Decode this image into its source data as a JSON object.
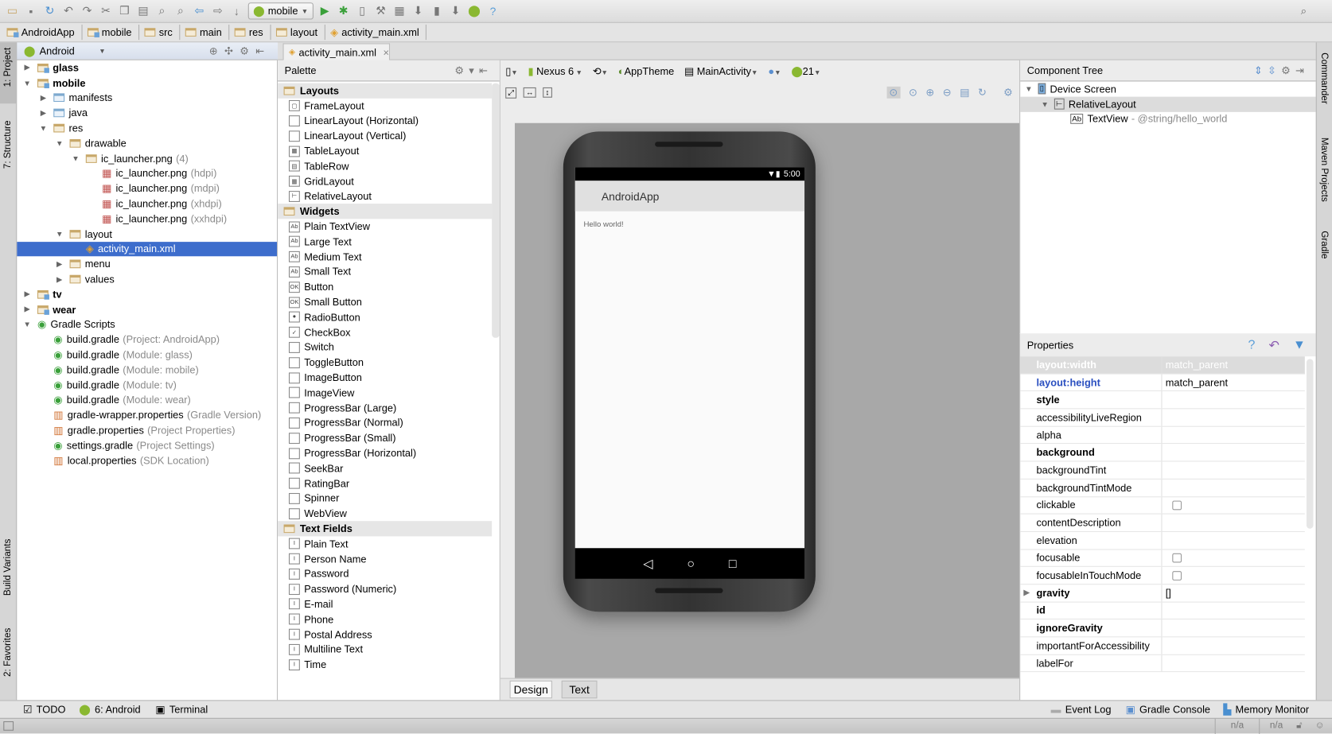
{
  "toolbar": {
    "run_config": "mobile",
    "icons": [
      "open-folder-icon",
      "save-icon",
      "sync-icon",
      "undo-icon",
      "redo-icon",
      "cut-icon",
      "copy-icon",
      "paste-icon",
      "find-icon",
      "replace-icon",
      "back-icon",
      "forward-icon",
      "make-icon",
      "run-icon",
      "debug-icon",
      "attach-debugger-icon",
      "project-structure-icon",
      "sdk-manager-icon",
      "android-device-monitor-icon",
      "avd-manager-icon",
      "sync-gradle-icon",
      "android-icon",
      "help-icon"
    ]
  },
  "breadcrumb": [
    "AndroidApp",
    "mobile",
    "src",
    "main",
    "res",
    "layout",
    "activity_main.xml"
  ],
  "left_strip": {
    "project": "1: Project",
    "structure": "7: Structure",
    "build_variants": "Build Variants",
    "favorites": "2: Favorites"
  },
  "right_strip": {
    "commander": "Commander",
    "maven": "Maven Projects",
    "gradle": "Gradle"
  },
  "project": {
    "view": "Android",
    "tree": [
      {
        "label": "glass",
        "level": 0,
        "arrow": "right",
        "icon": "module",
        "bold": true
      },
      {
        "label": "mobile",
        "level": 0,
        "arrow": "down",
        "icon": "module",
        "bold": true
      },
      {
        "label": "manifests",
        "level": 1,
        "arrow": "right",
        "icon": "blue"
      },
      {
        "label": "java",
        "level": 1,
        "arrow": "right",
        "icon": "blue"
      },
      {
        "label": "res",
        "level": 1,
        "arrow": "down",
        "icon": "res"
      },
      {
        "label": "drawable",
        "level": 2,
        "arrow": "down",
        "icon": "folder"
      },
      {
        "label": "ic_launcher.png",
        "hint": "(4)",
        "level": 3,
        "arrow": "down",
        "icon": "folder"
      },
      {
        "label": "ic_launcher.png",
        "hint": "(hdpi)",
        "level": 4,
        "icon": "image"
      },
      {
        "label": "ic_launcher.png",
        "hint": "(mdpi)",
        "level": 4,
        "icon": "image"
      },
      {
        "label": "ic_launcher.png",
        "hint": "(xhdpi)",
        "level": 4,
        "icon": "image"
      },
      {
        "label": "ic_launcher.png",
        "hint": "(xxhdpi)",
        "level": 4,
        "icon": "image"
      },
      {
        "label": "layout",
        "level": 2,
        "arrow": "down",
        "icon": "folder"
      },
      {
        "label": "activity_main.xml",
        "level": 3,
        "icon": "xml",
        "selected": true
      },
      {
        "label": "menu",
        "level": 2,
        "arrow": "right",
        "icon": "folder"
      },
      {
        "label": "values",
        "level": 2,
        "arrow": "right",
        "icon": "folder"
      },
      {
        "label": "tv",
        "level": 0,
        "arrow": "right",
        "icon": "module",
        "bold": true
      },
      {
        "label": "wear",
        "level": 0,
        "arrow": "right",
        "icon": "module",
        "bold": true
      },
      {
        "label": "Gradle Scripts",
        "level": 0,
        "arrow": "down",
        "icon": "gradle"
      },
      {
        "label": "build.gradle",
        "hint": "(Project: AndroidApp)",
        "level": 1,
        "icon": "gradle"
      },
      {
        "label": "build.gradle",
        "hint": "(Module: glass)",
        "level": 1,
        "icon": "gradle"
      },
      {
        "label": "build.gradle",
        "hint": "(Module: mobile)",
        "level": 1,
        "icon": "gradle"
      },
      {
        "label": "build.gradle",
        "hint": "(Module: tv)",
        "level": 1,
        "icon": "gradle"
      },
      {
        "label": "build.gradle",
        "hint": "(Module: wear)",
        "level": 1,
        "icon": "gradle"
      },
      {
        "label": "gradle-wrapper.properties",
        "hint": "(Gradle Version)",
        "level": 1,
        "icon": "props"
      },
      {
        "label": "gradle.properties",
        "hint": "(Project Properties)",
        "level": 1,
        "icon": "props"
      },
      {
        "label": "settings.gradle",
        "hint": "(Project Settings)",
        "level": 1,
        "icon": "gradle"
      },
      {
        "label": "local.properties",
        "hint": "(SDK Location)",
        "level": 1,
        "icon": "props"
      }
    ]
  },
  "editor_tab": "activity_main.xml",
  "palette": {
    "title": "Palette",
    "groups": [
      {
        "name": "Layouts",
        "items": [
          "FrameLayout",
          "LinearLayout (Horizontal)",
          "LinearLayout (Vertical)",
          "TableLayout",
          "TableRow",
          "GridLayout",
          "RelativeLayout"
        ]
      },
      {
        "name": "Widgets",
        "items": [
          "Plain TextView",
          "Large Text",
          "Medium Text",
          "Small Text",
          "Button",
          "Small Button",
          "RadioButton",
          "CheckBox",
          "Switch",
          "ToggleButton",
          "ImageButton",
          "ImageView",
          "ProgressBar (Large)",
          "ProgressBar (Normal)",
          "ProgressBar (Small)",
          "ProgressBar (Horizontal)",
          "SeekBar",
          "RatingBar",
          "Spinner",
          "WebView"
        ]
      },
      {
        "name": "Text Fields",
        "items": [
          "Plain Text",
          "Person Name",
          "Password",
          "Password (Numeric)",
          "E-mail",
          "Phone",
          "Postal Address",
          "Multiline Text",
          "Time"
        ]
      }
    ]
  },
  "designer": {
    "device": "Nexus 6",
    "theme": "AppTheme",
    "activity": "MainActivity",
    "api": "21",
    "phone": {
      "time": "5:00",
      "app_title": "AndroidApp",
      "content": "Hello world!"
    },
    "tabs": [
      "Design",
      "Text"
    ],
    "active_tab": "Design"
  },
  "component_tree": {
    "title": "Component Tree",
    "nodes": [
      {
        "label": "Device Screen",
        "level": 0
      },
      {
        "label": "RelativeLayout",
        "level": 1,
        "selected": true
      },
      {
        "label": "TextView",
        "hint": "- @string/hello_world",
        "level": 2
      }
    ]
  },
  "properties": {
    "title": "Properties",
    "rows": [
      {
        "name": "layout:width",
        "value": "match_parent",
        "header": true
      },
      {
        "name": "layout:height",
        "value": "match_parent",
        "modified": true
      },
      {
        "name": "style",
        "bold": true
      },
      {
        "name": "accessibilityLiveRegion"
      },
      {
        "name": "alpha"
      },
      {
        "name": "background",
        "bold": true
      },
      {
        "name": "backgroundTint"
      },
      {
        "name": "backgroundTintMode"
      },
      {
        "name": "clickable",
        "checkbox": true,
        "checked": false
      },
      {
        "name": "contentDescription"
      },
      {
        "name": "elevation"
      },
      {
        "name": "focusable",
        "checkbox": true,
        "checked": false
      },
      {
        "name": "focusableInTouchMode",
        "checkbox": true,
        "checked": false
      },
      {
        "name": "gravity",
        "value": "[]",
        "bold": true,
        "expandable": true
      },
      {
        "name": "id",
        "bold": true
      },
      {
        "name": "ignoreGravity",
        "bold": true
      },
      {
        "name": "importantForAccessibility"
      },
      {
        "name": "labelFor"
      }
    ]
  },
  "bottom_tools": {
    "todo": "TODO",
    "android": "6: Android",
    "terminal": "Terminal",
    "event_log": "Event Log",
    "gradle_console": "Gradle Console",
    "memory_monitor": "Memory Monitor"
  },
  "status": {
    "cell1": "n/a",
    "cell2": "n/a"
  },
  "colors": {
    "selection": "#3d6dcc",
    "canvas": "#a8a8a8",
    "modified": "#2a4fc0"
  }
}
